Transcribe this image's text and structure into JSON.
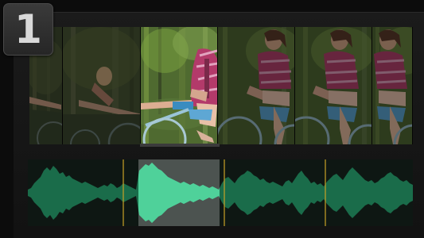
{
  "step": {
    "number": "1"
  },
  "filmstrip": {
    "frames": [
      {
        "name": "frame-1",
        "subject": "arm-reaching",
        "selected": false
      },
      {
        "name": "frame-2",
        "subject": "rider-leaning",
        "selected": false
      },
      {
        "name": "frame-3",
        "subject": "rider-on-bicycle",
        "selected": true
      },
      {
        "name": "frame-4",
        "subject": "rider-laughing",
        "selected": false
      },
      {
        "name": "frame-5",
        "subject": "rider-laughing",
        "selected": false
      },
      {
        "name": "frame-6",
        "subject": "rider-laughing",
        "selected": false
      }
    ]
  },
  "audio": {
    "selected_clip": 2,
    "colors": {
      "waveform": "#1f8a5e",
      "waveform_selected": "#4fd19a",
      "marker": "#c9a227"
    }
  },
  "colors": {
    "background": "#0c0c0c",
    "panel": "#1a1a1a",
    "badge": "#333333"
  }
}
